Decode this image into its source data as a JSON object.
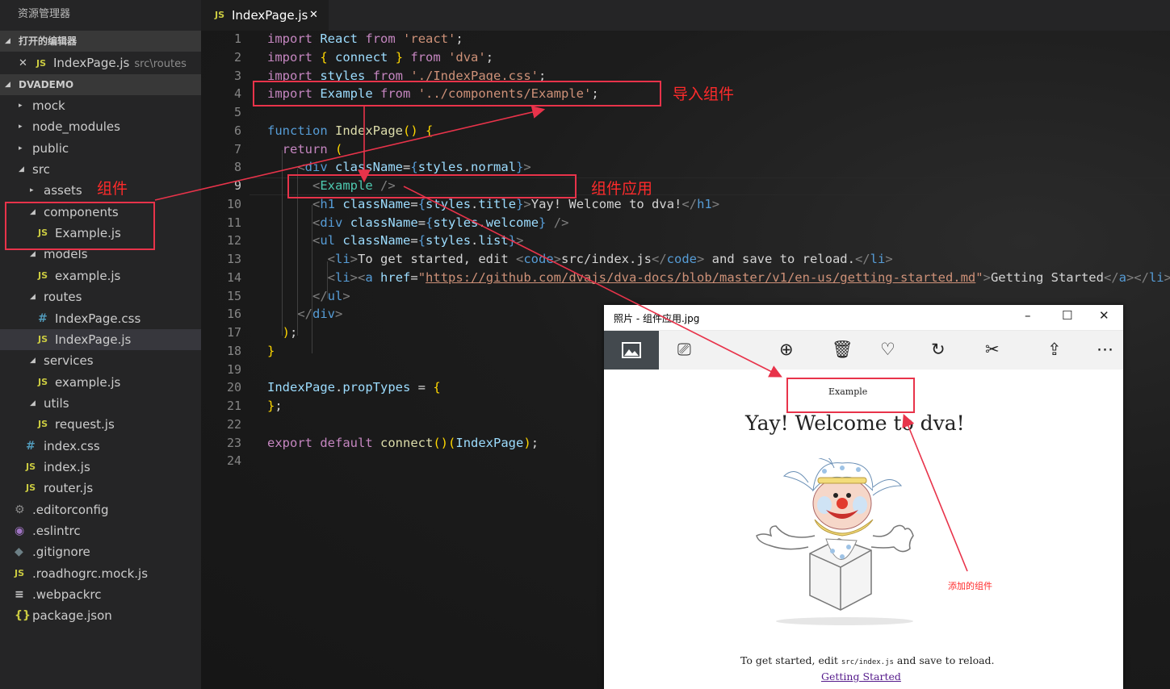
{
  "sidebar": {
    "title": "资源管理器",
    "open_editors_header": "打开的编辑器",
    "open_editor": {
      "close": "✕",
      "icon": "JS",
      "name": "IndexPage.js",
      "path": "src\\routes"
    },
    "project_header": "DVADEMO",
    "tree": [
      {
        "label": "mock",
        "depth": 1,
        "twisty": "▸",
        "icon": ""
      },
      {
        "label": "node_modules",
        "depth": 1,
        "twisty": "▸",
        "icon": ""
      },
      {
        "label": "public",
        "depth": 1,
        "twisty": "▸",
        "icon": ""
      },
      {
        "label": "src",
        "depth": 1,
        "twisty": "◢",
        "icon": ""
      },
      {
        "label": "assets",
        "depth": 2,
        "twisty": "▸",
        "icon": ""
      },
      {
        "label": "components",
        "depth": 2,
        "twisty": "◢",
        "icon": ""
      },
      {
        "label": "Example.js",
        "depth": 3,
        "twisty": "",
        "icon": "JS"
      },
      {
        "label": "models",
        "depth": 2,
        "twisty": "◢",
        "icon": ""
      },
      {
        "label": "example.js",
        "depth": 3,
        "twisty": "",
        "icon": "JS"
      },
      {
        "label": "routes",
        "depth": 2,
        "twisty": "◢",
        "icon": ""
      },
      {
        "label": "IndexPage.css",
        "depth": 3,
        "twisty": "",
        "icon": "#"
      },
      {
        "label": "IndexPage.js",
        "depth": 3,
        "twisty": "",
        "icon": "JS",
        "selected": true
      },
      {
        "label": "services",
        "depth": 2,
        "twisty": "◢",
        "icon": ""
      },
      {
        "label": "example.js",
        "depth": 3,
        "twisty": "",
        "icon": "JS"
      },
      {
        "label": "utils",
        "depth": 2,
        "twisty": "◢",
        "icon": ""
      },
      {
        "label": "request.js",
        "depth": 3,
        "twisty": "",
        "icon": "JS"
      },
      {
        "label": "index.css",
        "depth": 2,
        "twisty": "",
        "icon": "#"
      },
      {
        "label": "index.js",
        "depth": 2,
        "twisty": "",
        "icon": "JS"
      },
      {
        "label": "router.js",
        "depth": 2,
        "twisty": "",
        "icon": "JS"
      },
      {
        "label": ".editorconfig",
        "depth": 1,
        "twisty": "",
        "icon": "gear-icon"
      },
      {
        "label": ".eslintrc",
        "depth": 1,
        "twisty": "",
        "icon": "eslint-icon"
      },
      {
        "label": ".gitignore",
        "depth": 1,
        "twisty": "",
        "icon": "git-icon"
      },
      {
        "label": ".roadhogrc.mock.js",
        "depth": 1,
        "twisty": "",
        "icon": "JS"
      },
      {
        "label": ".webpackrc",
        "depth": 1,
        "twisty": "",
        "icon": "lines-icon"
      },
      {
        "label": "package.json",
        "depth": 1,
        "twisty": "",
        "icon": "{}"
      }
    ]
  },
  "editor": {
    "tab": {
      "icon": "JS",
      "name": "IndexPage.js",
      "close": "✕"
    },
    "current_line": 9,
    "lines": [
      [
        [
          "k",
          "import"
        ],
        [
          "p",
          " "
        ],
        [
          "v",
          "React"
        ],
        [
          "p",
          " "
        ],
        [
          "k",
          "from"
        ],
        [
          "p",
          " "
        ],
        [
          "s",
          "'react'"
        ],
        [
          "p",
          ";"
        ]
      ],
      [
        [
          "k",
          "import"
        ],
        [
          "p",
          " "
        ],
        [
          "br",
          "{"
        ],
        [
          "p",
          " "
        ],
        [
          "v",
          "connect"
        ],
        [
          "p",
          " "
        ],
        [
          "br",
          "}"
        ],
        [
          "p",
          " "
        ],
        [
          "k",
          "from"
        ],
        [
          "p",
          " "
        ],
        [
          "s",
          "'dva'"
        ],
        [
          "p",
          ";"
        ]
      ],
      [
        [
          "k",
          "import"
        ],
        [
          "p",
          " "
        ],
        [
          "v",
          "styles"
        ],
        [
          "p",
          " "
        ],
        [
          "k",
          "from"
        ],
        [
          "p",
          " "
        ],
        [
          "s",
          "'./IndexPage.css'"
        ],
        [
          "p",
          ";"
        ]
      ],
      [
        [
          "k",
          "import"
        ],
        [
          "p",
          " "
        ],
        [
          "v",
          "Example"
        ],
        [
          "p",
          " "
        ],
        [
          "k",
          "from"
        ],
        [
          "p",
          " "
        ],
        [
          "s",
          "'../components/Example'"
        ],
        [
          "p",
          ";"
        ]
      ],
      [],
      [
        [
          "kb",
          "function"
        ],
        [
          "p",
          " "
        ],
        [
          "fn",
          "IndexPage"
        ],
        [
          "br",
          "()"
        ],
        [
          "p",
          " "
        ],
        [
          "br",
          "{"
        ]
      ],
      [
        [
          "p",
          "  "
        ],
        [
          "k",
          "return"
        ],
        [
          "p",
          " "
        ],
        [
          "br",
          "("
        ]
      ],
      [
        [
          "p",
          "    "
        ],
        [
          "tg",
          "<"
        ],
        [
          "t",
          "div"
        ],
        [
          "p",
          " "
        ],
        [
          "v",
          "className"
        ],
        [
          "p",
          "="
        ],
        [
          "kb",
          "{"
        ],
        [
          "v",
          "styles"
        ],
        [
          "p",
          "."
        ],
        [
          "v",
          "normal"
        ],
        [
          "kb",
          "}"
        ],
        [
          "tg",
          ">"
        ]
      ],
      [
        [
          "p",
          "      "
        ],
        [
          "tg",
          "<"
        ],
        [
          "gn",
          "Example"
        ],
        [
          "p",
          " "
        ],
        [
          "tg",
          "/>"
        ]
      ],
      [
        [
          "p",
          "      "
        ],
        [
          "tg",
          "<"
        ],
        [
          "t",
          "h1"
        ],
        [
          "p",
          " "
        ],
        [
          "v",
          "className"
        ],
        [
          "p",
          "="
        ],
        [
          "kb",
          "{"
        ],
        [
          "v",
          "styles"
        ],
        [
          "p",
          "."
        ],
        [
          "v",
          "title"
        ],
        [
          "kb",
          "}"
        ],
        [
          "tg",
          ">"
        ],
        [
          "p",
          "Yay! Welcome to dva!"
        ],
        [
          "tg",
          "</"
        ],
        [
          "t",
          "h1"
        ],
        [
          "tg",
          ">"
        ]
      ],
      [
        [
          "p",
          "      "
        ],
        [
          "tg",
          "<"
        ],
        [
          "t",
          "div"
        ],
        [
          "p",
          " "
        ],
        [
          "v",
          "className"
        ],
        [
          "p",
          "="
        ],
        [
          "kb",
          "{"
        ],
        [
          "v",
          "styles"
        ],
        [
          "p",
          "."
        ],
        [
          "v",
          "welcome"
        ],
        [
          "kb",
          "}"
        ],
        [
          "p",
          " "
        ],
        [
          "tg",
          "/>"
        ]
      ],
      [
        [
          "p",
          "      "
        ],
        [
          "tg",
          "<"
        ],
        [
          "t",
          "ul"
        ],
        [
          "p",
          " "
        ],
        [
          "v",
          "className"
        ],
        [
          "p",
          "="
        ],
        [
          "kb",
          "{"
        ],
        [
          "v",
          "styles"
        ],
        [
          "p",
          "."
        ],
        [
          "v",
          "list"
        ],
        [
          "kb",
          "}"
        ],
        [
          "tg",
          ">"
        ]
      ],
      [
        [
          "p",
          "        "
        ],
        [
          "tg",
          "<"
        ],
        [
          "t",
          "li"
        ],
        [
          "tg",
          ">"
        ],
        [
          "p",
          "To get started, edit "
        ],
        [
          "tg",
          "<"
        ],
        [
          "t",
          "code"
        ],
        [
          "tg",
          ">"
        ],
        [
          "p",
          "src/index.js"
        ],
        [
          "tg",
          "</"
        ],
        [
          "t",
          "code"
        ],
        [
          "tg",
          ">"
        ],
        [
          "p",
          " and save to reload."
        ],
        [
          "tg",
          "</"
        ],
        [
          "t",
          "li"
        ],
        [
          "tg",
          ">"
        ]
      ],
      [
        [
          "p",
          "        "
        ],
        [
          "tg",
          "<"
        ],
        [
          "t",
          "li"
        ],
        [
          "tg",
          "><"
        ],
        [
          "t",
          "a"
        ],
        [
          "p",
          " "
        ],
        [
          "v",
          "href"
        ],
        [
          "p",
          "="
        ],
        [
          "s",
          "\""
        ],
        [
          "u",
          "https://github.com/dvajs/dva-docs/blob/master/v1/en-us/getting-started.md"
        ],
        [
          "s",
          "\""
        ],
        [
          "tg",
          ">"
        ],
        [
          "p",
          "Getting Started"
        ],
        [
          "tg",
          "</"
        ],
        [
          "t",
          "a"
        ],
        [
          "tg",
          "></"
        ],
        [
          "t",
          "li"
        ],
        [
          "tg",
          ">"
        ]
      ],
      [
        [
          "p",
          "      "
        ],
        [
          "tg",
          "</"
        ],
        [
          "t",
          "ul"
        ],
        [
          "tg",
          ">"
        ]
      ],
      [
        [
          "p",
          "    "
        ],
        [
          "tg",
          "</"
        ],
        [
          "t",
          "div"
        ],
        [
          "tg",
          ">"
        ]
      ],
      [
        [
          "p",
          "  "
        ],
        [
          "br",
          ")"
        ],
        [
          "p",
          ";"
        ]
      ],
      [
        [
          "br",
          "}"
        ]
      ],
      [],
      [
        [
          "v",
          "IndexPage"
        ],
        [
          "p",
          "."
        ],
        [
          "v",
          "propTypes"
        ],
        [
          "p",
          " = "
        ],
        [
          "br",
          "{"
        ]
      ],
      [
        [
          "br",
          "}"
        ],
        [
          "p",
          ";"
        ]
      ],
      [],
      [
        [
          "k",
          "export"
        ],
        [
          "p",
          " "
        ],
        [
          "k",
          "default"
        ],
        [
          "p",
          " "
        ],
        [
          "fn",
          "connect"
        ],
        [
          "br",
          "()"
        ],
        [
          "br",
          "("
        ],
        [
          "v",
          "IndexPage"
        ],
        [
          "br",
          ")"
        ],
        [
          "p",
          ";"
        ]
      ],
      []
    ]
  },
  "annotations": {
    "import_label": "导入组件",
    "component_label": "组件",
    "usage_label": "组件应用",
    "added_label": "添加的组件",
    "color": "#e8334a"
  },
  "photos_window": {
    "title": "照片 - 组件应用.jpg",
    "controls": {
      "minimize": "–",
      "maximize": "☐",
      "close": "✕"
    },
    "toolbar_icons": [
      "image-icon",
      "slideshow-icon",
      "zoom-in-icon",
      "delete-icon",
      "favorite-icon",
      "rotate-icon",
      "edit-icon",
      "share-icon",
      "more-icon"
    ],
    "example_text": "Example",
    "heading": "Yay! Welcome to dva!",
    "getting_started_prefix": "To get started, edit ",
    "getting_started_code": "src/index.js",
    "getting_started_suffix": " and save to reload.",
    "link": "Getting Started"
  },
  "colors": {
    "sidebar_bg": "#252526",
    "editor_bg": "#1e1e1e",
    "js_icon": "#cbcb41",
    "css_icon": "#519aba",
    "link": "#551a8b"
  }
}
